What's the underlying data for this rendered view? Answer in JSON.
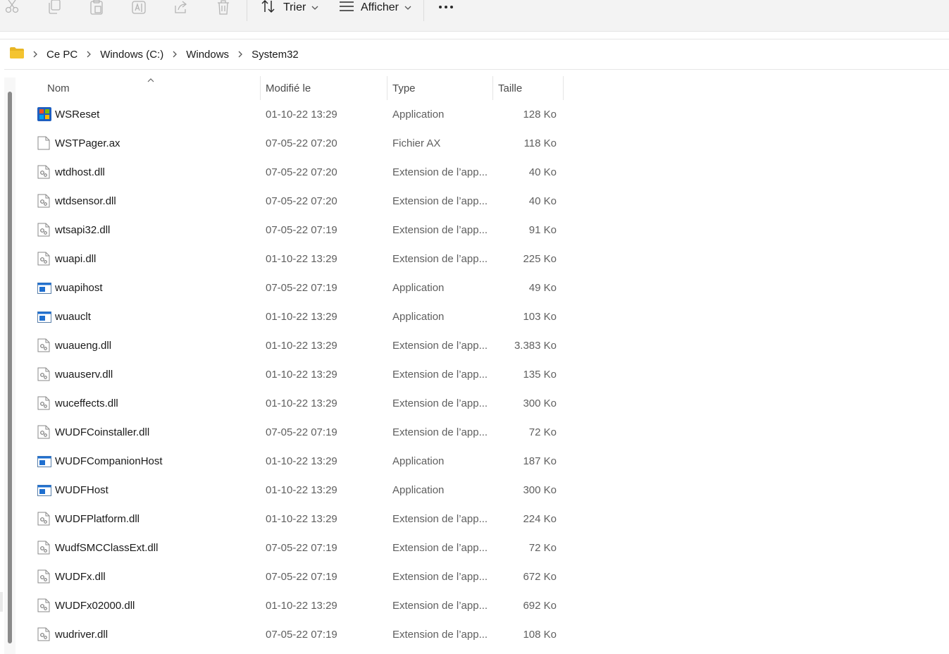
{
  "toolbar": {
    "sort_label": "Trier",
    "view_label": "Afficher",
    "icons": [
      "cut-icon",
      "copy-icon",
      "paste-icon",
      "rename-icon",
      "share-icon",
      "delete-icon"
    ]
  },
  "breadcrumb": {
    "items": [
      "Ce PC",
      "Windows (C:)",
      "Windows",
      "System32"
    ]
  },
  "columns": {
    "name": "Nom",
    "modified": "Modifié le",
    "type": "Type",
    "size": "Taille"
  },
  "files": [
    {
      "name": "WSReset",
      "modified": "01-10-22 13:29",
      "type": "Application",
      "size": "128 Ko",
      "icon": "store-app"
    },
    {
      "name": "WSTPager.ax",
      "modified": "07-05-22 07:20",
      "type": "Fichier AX",
      "size": "118 Ko",
      "icon": "file"
    },
    {
      "name": "wtdhost.dll",
      "modified": "07-05-22 07:20",
      "type": "Extension de l’app...",
      "size": "40 Ko",
      "icon": "dll"
    },
    {
      "name": "wtdsensor.dll",
      "modified": "07-05-22 07:20",
      "type": "Extension de l’app...",
      "size": "40 Ko",
      "icon": "dll"
    },
    {
      "name": "wtsapi32.dll",
      "modified": "07-05-22 07:19",
      "type": "Extension de l’app...",
      "size": "91 Ko",
      "icon": "dll"
    },
    {
      "name": "wuapi.dll",
      "modified": "01-10-22 13:29",
      "type": "Extension de l’app...",
      "size": "225 Ko",
      "icon": "dll"
    },
    {
      "name": "wuapihost",
      "modified": "07-05-22 07:19",
      "type": "Application",
      "size": "49 Ko",
      "icon": "app"
    },
    {
      "name": "wuauclt",
      "modified": "01-10-22 13:29",
      "type": "Application",
      "size": "103 Ko",
      "icon": "app"
    },
    {
      "name": "wuaueng.dll",
      "modified": "01-10-22 13:29",
      "type": "Extension de l’app...",
      "size": "3.383 Ko",
      "icon": "dll"
    },
    {
      "name": "wuauserv.dll",
      "modified": "01-10-22 13:29",
      "type": "Extension de l’app...",
      "size": "135 Ko",
      "icon": "dll"
    },
    {
      "name": "wuceffects.dll",
      "modified": "01-10-22 13:29",
      "type": "Extension de l’app...",
      "size": "300 Ko",
      "icon": "dll"
    },
    {
      "name": "WUDFCoinstaller.dll",
      "modified": "07-05-22 07:19",
      "type": "Extension de l’app...",
      "size": "72 Ko",
      "icon": "dll"
    },
    {
      "name": "WUDFCompanionHost",
      "modified": "01-10-22 13:29",
      "type": "Application",
      "size": "187 Ko",
      "icon": "app"
    },
    {
      "name": "WUDFHost",
      "modified": "01-10-22 13:29",
      "type": "Application",
      "size": "300 Ko",
      "icon": "app"
    },
    {
      "name": "WUDFPlatform.dll",
      "modified": "01-10-22 13:29",
      "type": "Extension de l’app...",
      "size": "224 Ko",
      "icon": "dll"
    },
    {
      "name": "WudfSMCClassExt.dll",
      "modified": "07-05-22 07:19",
      "type": "Extension de l’app...",
      "size": "72 Ko",
      "icon": "dll"
    },
    {
      "name": "WUDFx.dll",
      "modified": "07-05-22 07:19",
      "type": "Extension de l’app...",
      "size": "672 Ko",
      "icon": "dll"
    },
    {
      "name": "WUDFx02000.dll",
      "modified": "01-10-22 13:29",
      "type": "Extension de l’app...",
      "size": "692 Ko",
      "icon": "dll"
    },
    {
      "name": "wudriver.dll",
      "modified": "07-05-22 07:19",
      "type": "Extension de l’app...",
      "size": "108 Ko",
      "icon": "dll"
    }
  ],
  "colors": {
    "toolbar_bg": "#f3f3f3",
    "folder_yellow": "#f4c430",
    "app_blue": "#1e6fd0",
    "muted_text": "#5f5f5f"
  }
}
